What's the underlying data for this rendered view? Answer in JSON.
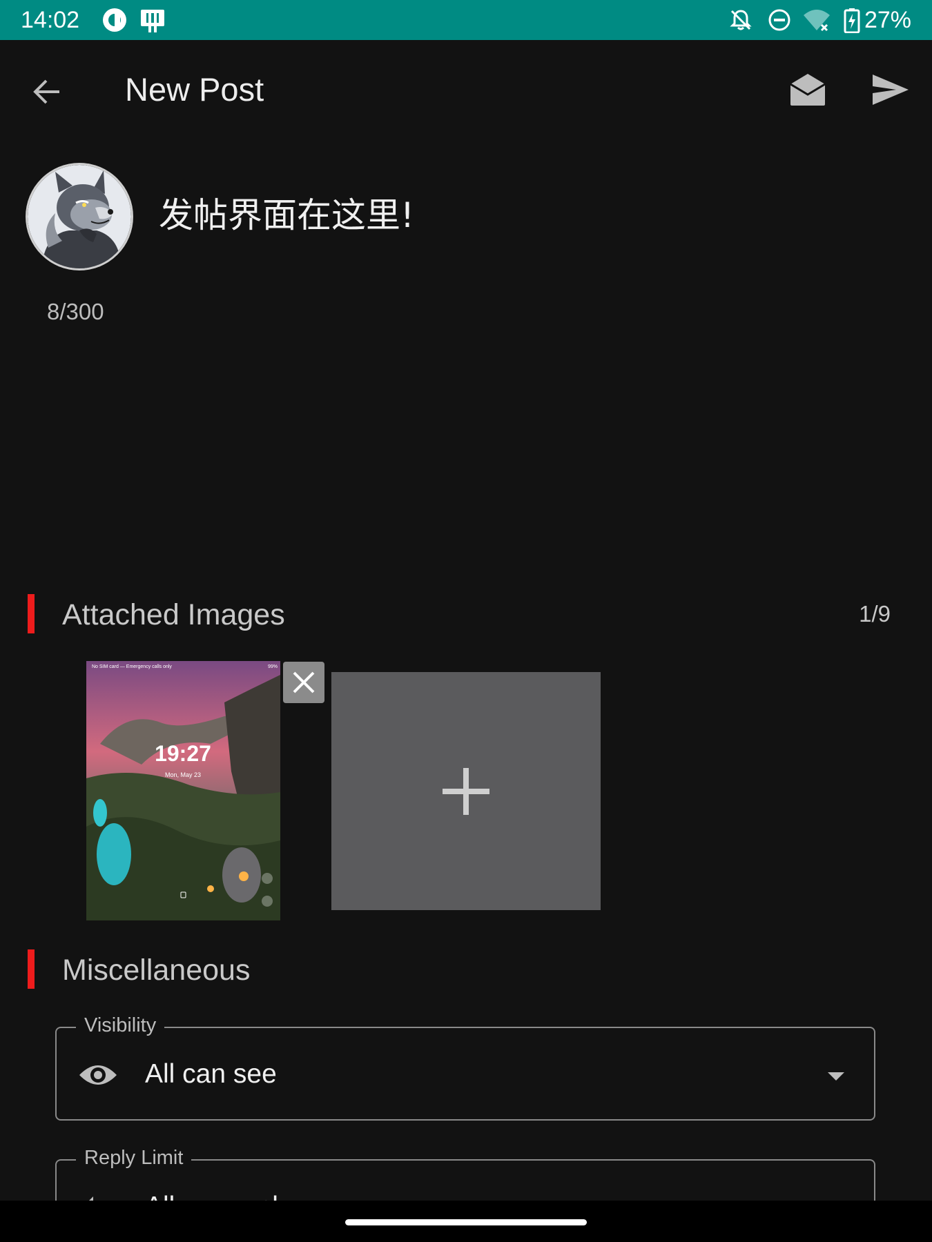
{
  "status_bar": {
    "time": "14:02",
    "battery_text": "27%",
    "left_icons": [
      "pocket-casts-icon",
      "tablet-mode-icon"
    ],
    "right_icons": [
      "notifications-off-icon",
      "do-not-disturb-icon",
      "wifi-no-internet-icon",
      "battery-charging-icon"
    ],
    "background_color": "#008b83"
  },
  "app_bar": {
    "title": "New Post",
    "back_icon": "arrow-back-icon",
    "draft_icon": "drafts-icon",
    "send_icon": "send-icon"
  },
  "composer": {
    "post_text": "发帖界面在这里!",
    "char_count": "8/300",
    "avatar_icon": "wolf-avatar"
  },
  "attached_images": {
    "title": "Attached Images",
    "count": "1/9",
    "thumbnail": {
      "time": "19:27",
      "date": "Mon, May 23",
      "status": "No SIM card — Emergency calls only",
      "battery": "99%"
    },
    "remove_icon": "close-icon",
    "add_icon": "plus-icon"
  },
  "miscellaneous": {
    "title": "Miscellaneous",
    "visibility": {
      "label": "Visibility",
      "value": "All can see",
      "icon": "eye-icon"
    },
    "reply_limit": {
      "label": "Reply Limit",
      "value": "All can reply"
    }
  },
  "colors": {
    "background": "#121212",
    "accent": "#ee1c1c",
    "status_bar": "#008b83",
    "add_tile": "#5b5b5d"
  }
}
